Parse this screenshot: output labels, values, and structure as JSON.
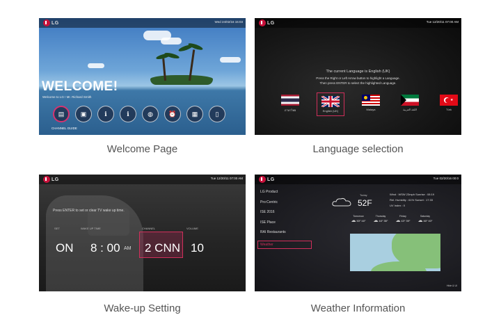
{
  "welcome": {
    "clock": "Wed 24/02/16 15:03",
    "title": "WELCOME!",
    "subtitle": "Welcome to LG ! Mr. Richard Smith",
    "active_label": "CHANNEL GUIDE",
    "caption": "Welcome Page"
  },
  "language": {
    "clock": "Tue 12/20/11 07:00 AM",
    "current": "The current Language is English (UK)",
    "hint1": "Press the Right or Left Arrow button to highlight a Language.",
    "hint2": "Then press ENTER to select the highlighted Language.",
    "flags": [
      "ภาษาไทย",
      "English (UK)",
      "Malaya",
      "اللغة العربية",
      "Türk"
    ],
    "caption": "Language selection"
  },
  "wakeup": {
    "clock": "Tue 12/20/11 07:00 AM",
    "prompt": "Press ENTER to set or clear TV wake up time.",
    "labels": {
      "set": "SET",
      "time": "WAKE UP TIME",
      "channel": "CHANNEL",
      "volume": "VOLUME"
    },
    "values": {
      "set": "ON",
      "time": "8 : 00",
      "am": "AM",
      "channel": "2 CNN",
      "volume": "10"
    },
    "caption": "Wake-up Setting"
  },
  "weather": {
    "clock": "Tue 02/20/16 00:0",
    "menu": [
      "LG Product",
      "Pro:Centric",
      "ISE 2016",
      "ISE Place",
      "RAI Restaurants",
      "Weather"
    ],
    "today": "Today",
    "temp": "52F",
    "wind": "Wind : WSW 23mph  Sunrise : 08:19",
    "humidity": "Rel. Humidity : 61%  Sunset : 17:33",
    "uv": "UV Index : 0",
    "forecast": [
      {
        "day": "Tomorrow",
        "hi": "50F",
        "lo": "44F"
      },
      {
        "day": "Thursday",
        "hi": "44F",
        "lo": "38F"
      },
      {
        "day": "Friday",
        "hi": "42F",
        "lo": "39F"
      },
      {
        "day": "Saturday",
        "hi": "46F",
        "lo": "40F"
      }
    ],
    "footer": "Hide & UI",
    "caption": "Weather Information"
  },
  "colors": {
    "highlight": "#d12f5b",
    "lg_red": "#c8103a"
  }
}
